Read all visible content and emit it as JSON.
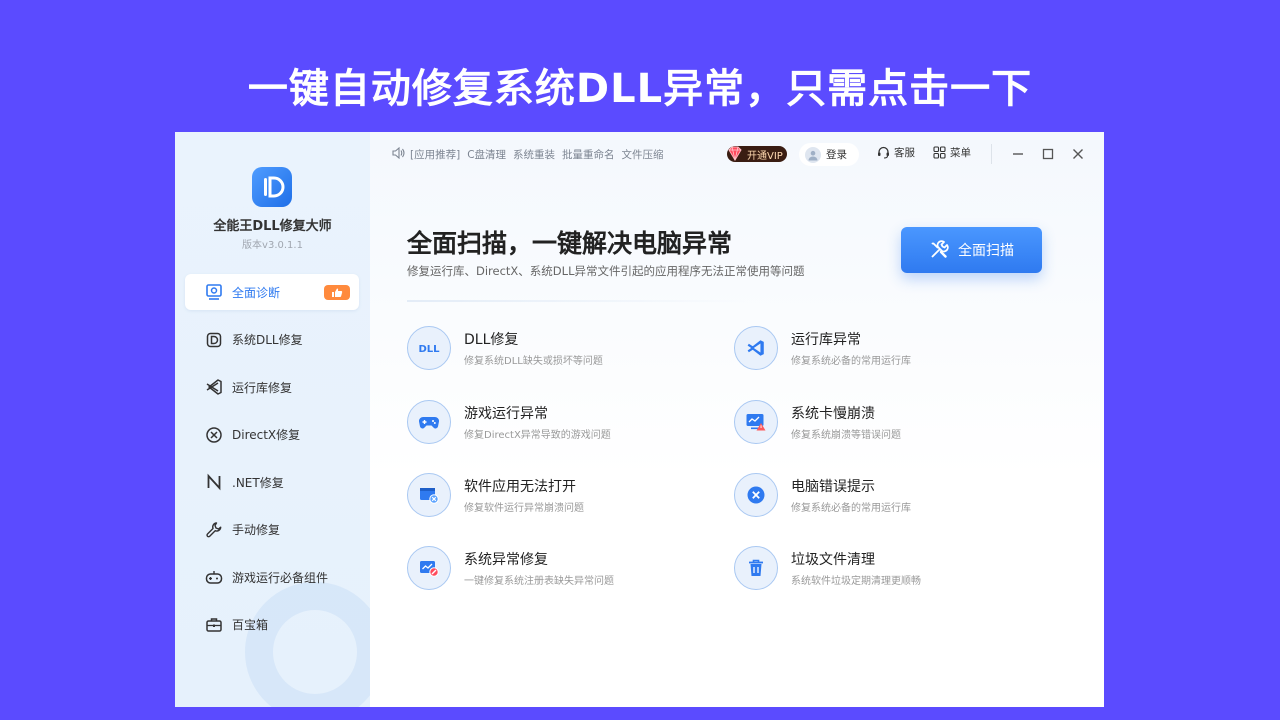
{
  "headline": "一键自动修复系统DLL异常，只需点击一下",
  "sidebar": {
    "app_name": "全能王DLL修复大师",
    "version": "版本v3.0.1.1",
    "items": [
      {
        "label": "全面诊断",
        "icon": "scan-screen-icon",
        "active": true,
        "badge_icon": "thumbs-up-icon"
      },
      {
        "label": "系统DLL修复",
        "icon": "dll-d-icon"
      },
      {
        "label": "运行库修复",
        "icon": "visual-studio-icon"
      },
      {
        "label": "DirectX修复",
        "icon": "directx-icon"
      },
      {
        "label": ".NET修复",
        "icon": "dotnet-n-icon"
      },
      {
        "label": "手动修复",
        "icon": "wrench-icon"
      },
      {
        "label": "游戏运行必备组件",
        "icon": "gamepad-icon"
      },
      {
        "label": "百宝箱",
        "icon": "toolbox-icon"
      }
    ]
  },
  "topbar": {
    "links": [
      "[应用推荐]",
      "C盘清理",
      "系统重装",
      "批量重命名",
      "文件压缩"
    ],
    "vip_label": "开通VIP",
    "login_label": "登录",
    "service_label": "客服",
    "menu_label": "菜单"
  },
  "hero": {
    "title": "全面扫描，一键解决电脑异常",
    "subtitle": "修复运行库、DirectX、系统DLL异常文件引起的应用程序无法正常使用等问题",
    "scan_button": "全面扫描"
  },
  "features": [
    {
      "title": "DLL修复",
      "desc": "修复系统DLL缺失或损坏等问题",
      "icon": "dll-icon"
    },
    {
      "title": "运行库异常",
      "desc": "修复系统必备的常用运行库",
      "icon": "visual-studio-icon"
    },
    {
      "title": "游戏运行异常",
      "desc": "修复DirectX异常导致的游戏问题",
      "icon": "gamepad-icon"
    },
    {
      "title": "系统卡慢崩溃",
      "desc": "修复系统崩溃等错误问题",
      "icon": "monitor-warning-icon"
    },
    {
      "title": "软件应用无法打开",
      "desc": "修复软件运行异常崩溃问题",
      "icon": "window-error-icon"
    },
    {
      "title": "电脑错误提示",
      "desc": "修复系统必备的常用运行库",
      "icon": "error-x-icon"
    },
    {
      "title": "系统异常修复",
      "desc": "一键修复系统注册表缺失异常问题",
      "icon": "system-repair-icon"
    },
    {
      "title": "垃圾文件清理",
      "desc": "系统软件垃圾定期清理更顺畅",
      "icon": "trash-icon"
    }
  ],
  "colors": {
    "background": "#5b4bff",
    "accent": "#2f7af0",
    "badge": "#ff8a3d"
  }
}
